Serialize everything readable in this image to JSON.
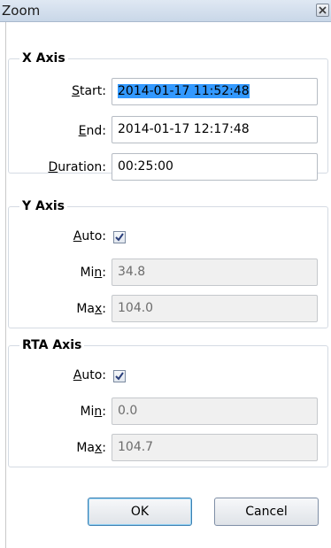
{
  "window": {
    "title": "Zoom",
    "close_icon": "close-x-icon"
  },
  "x_axis": {
    "legend": "X Axis",
    "start_label_hotkey": "S",
    "start_label_rest": "tart:",
    "start_value": "2014-01-17 11:52:48",
    "end_label_hotkey": "E",
    "end_label_rest": "nd:",
    "end_value": "2014-01-17 12:17:48",
    "duration_label_hotkey": "D",
    "duration_label_rest": "uration:",
    "duration_value": "00:25:00"
  },
  "y_axis": {
    "legend": "Y Axis",
    "auto_label_hotkey": "A",
    "auto_label_rest": "uto:",
    "auto_checked": true,
    "min_label_pre": "Mi",
    "min_label_hotkey": "n",
    "min_label_post": ":",
    "min_value": "34.8",
    "max_label_pre": "Ma",
    "max_label_hotkey": "x",
    "max_label_post": ":",
    "max_value": "104.0"
  },
  "rta_axis": {
    "legend": "RTA Axis",
    "auto_label_hotkey": "A",
    "auto_label_rest": "uto:",
    "auto_checked": true,
    "min_label_pre": "Mi",
    "min_label_hotkey": "n",
    "min_label_post": ":",
    "min_value": "0.0",
    "max_label_pre": "Ma",
    "max_label_hotkey": "x",
    "max_label_post": ":",
    "max_value": "104.7"
  },
  "buttons": {
    "ok_label": "OK",
    "cancel_label": "Cancel"
  }
}
